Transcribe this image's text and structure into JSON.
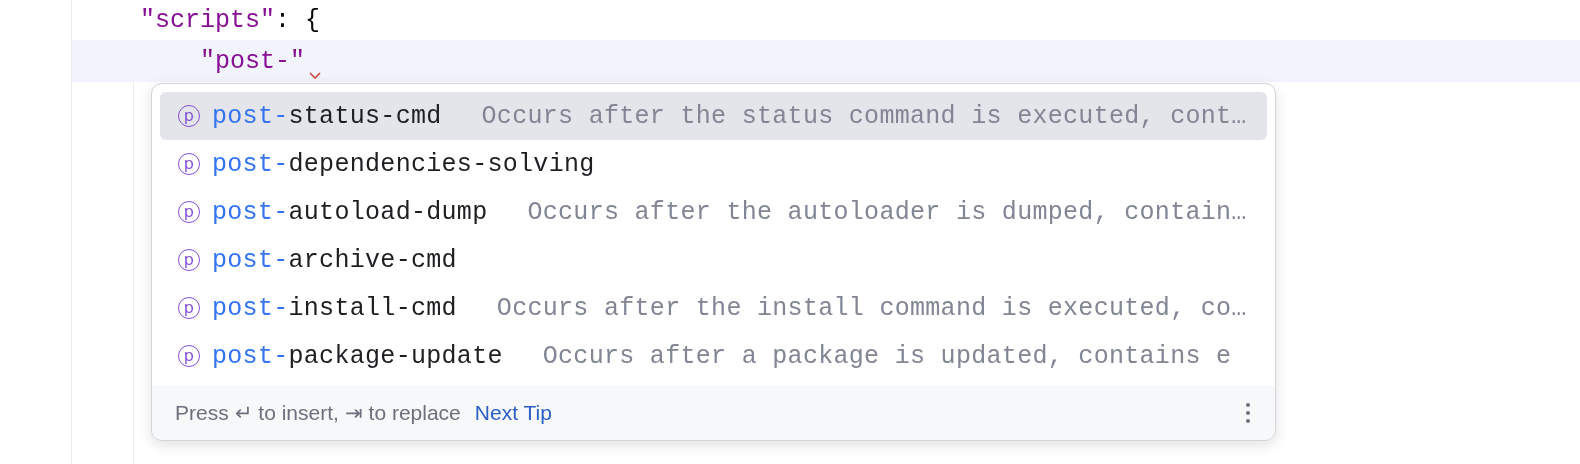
{
  "editor": {
    "lines": [
      {
        "current": false,
        "error_mark": false,
        "tokens": [
          {
            "kind": "string",
            "text": "\"scripts\""
          },
          {
            "kind": "punct",
            "text": ": {"
          }
        ]
      },
      {
        "current": true,
        "error_mark": true,
        "tokens": [
          {
            "kind": "string",
            "text": "\"post-\""
          }
        ]
      }
    ]
  },
  "completion": {
    "items": [
      {
        "icon": "p",
        "prefix": "post-",
        "name": "status-cmd",
        "description": "Occurs after the status command is executed, cont…",
        "selected": true
      },
      {
        "icon": "p",
        "prefix": "post-",
        "name": "dependencies-solving",
        "selected": false
      },
      {
        "icon": "p",
        "prefix": "post-",
        "name": "autoload-dump",
        "description": "Occurs after the autoloader is dumped, contain…",
        "selected": false
      },
      {
        "icon": "p",
        "prefix": "post-",
        "name": "archive-cmd",
        "selected": false
      },
      {
        "icon": "p",
        "prefix": "post-",
        "name": "install-cmd",
        "description": "Occurs after the install command is executed, co…",
        "selected": false
      },
      {
        "icon": "p",
        "prefix": "post-",
        "name": "package-update",
        "description": "Occurs after a package is updated, contains e",
        "selected": false
      }
    ],
    "footer": {
      "hint": "Press ↵ to insert, ⇥ to replace",
      "link": "Next Tip"
    }
  }
}
